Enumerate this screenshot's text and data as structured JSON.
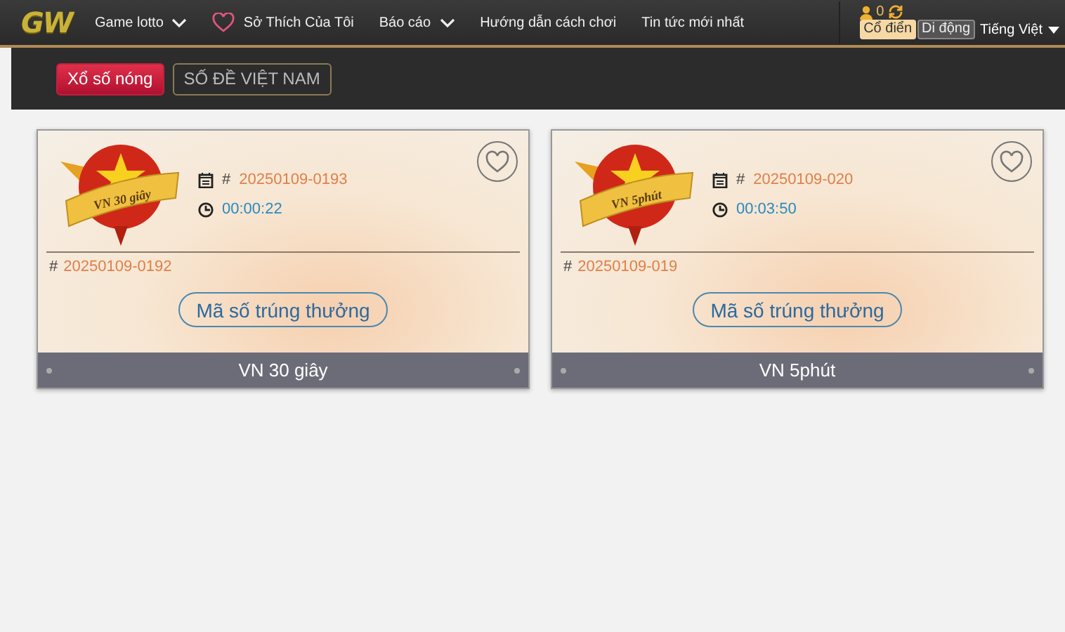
{
  "logo": "GW",
  "nav": [
    {
      "label": "Game lotto",
      "kind": "dropdown"
    },
    {
      "label": "Sở Thích Của Tôi",
      "kind": "favorite"
    },
    {
      "label": "Báo cáo",
      "kind": "dropdown"
    },
    {
      "label": "Hướng dẫn cách chơi",
      "kind": "plain"
    },
    {
      "label": "Tin tức mới nhất",
      "kind": "plain"
    }
  ],
  "account": {
    "balance": "0"
  },
  "view_modes": [
    {
      "label": "Cổ điển",
      "selected": true
    },
    {
      "label": "Di động",
      "selected": false
    }
  ],
  "language": "Tiếng Việt",
  "filters": [
    {
      "label": "Xổ số nóng",
      "selected": true
    },
    {
      "label": "SỐ ĐỀ VIỆT NAM",
      "selected": false
    }
  ],
  "games": [
    {
      "badge": "VN 30 giây",
      "current_mark": "#",
      "current_draw": "20250109-0193",
      "countdown": "00:00:22",
      "last_mark": "#",
      "last_draw": "20250109-0192",
      "button": "Mã số trúng thưởng",
      "name": "VN 30 giây",
      "favorite": false
    },
    {
      "badge": "VN 5phút",
      "current_mark": "#",
      "current_draw": "20250109-020",
      "countdown": "00:03:50",
      "last_mark": "#",
      "last_draw": "20250109-019",
      "button": "Mã số trúng thưởng",
      "name": "VN 5phút",
      "favorite": false
    }
  ]
}
